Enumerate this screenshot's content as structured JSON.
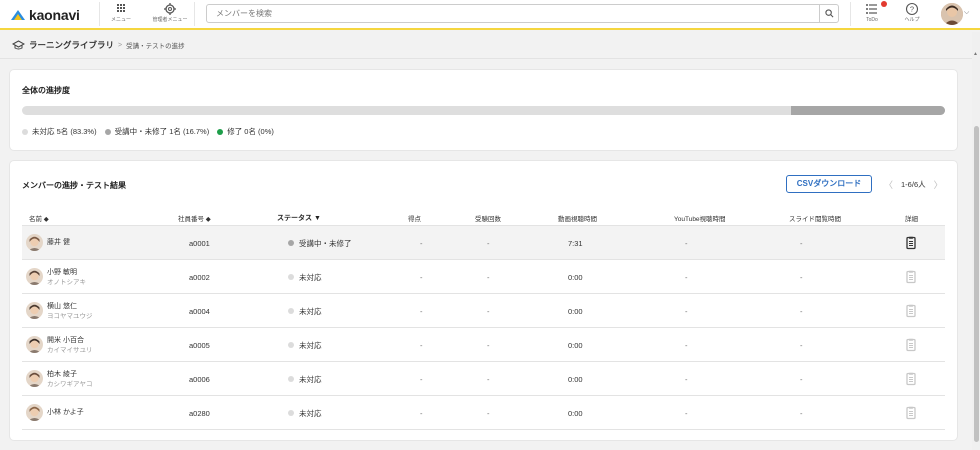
{
  "header": {
    "logo_text": "kaonavi",
    "nav": [
      {
        "label": "メニュー",
        "icon": "grid-icon"
      },
      {
        "label": "管理者メニュー",
        "icon": "gear-icon"
      }
    ],
    "search_placeholder": "メンバーを検索",
    "todo_label": "ToDo",
    "help_label": "ヘルプ"
  },
  "breadcrumb": {
    "parent": "ラーニングライブラリ",
    "separator": ">",
    "current": "受講・テストの進捗"
  },
  "overall": {
    "title": "全体の進捗度",
    "progress_in_progress_fraction": 0.167,
    "legend": [
      {
        "label": "未対応 5名 (83.3%)",
        "color": "#dcdcdc"
      },
      {
        "label": "受講中・未修了 1名 (16.7%)",
        "color": "#a6a6a6"
      },
      {
        "label": "修了 0名 (0%)",
        "color": "#1e9e4a"
      }
    ]
  },
  "members": {
    "title": "メンバーの進捗・テスト結果",
    "csv_label": "CSVダウンロード",
    "pager_text": "1-6/6人",
    "pager_prev": "〈",
    "pager_next": "〉",
    "columns": {
      "name": "名前 ◆",
      "employee_no": "社員番号 ◆",
      "status": "ステータス ▼",
      "score": "得点",
      "attempts": "受験回数",
      "video_time": "動画視聴時間",
      "youtube_time": "YouTube視聴時間",
      "slide_time": "スライド閲覧時間",
      "detail": "詳細"
    },
    "rows": [
      {
        "name": "藤井 健",
        "kana": "",
        "no": "a0001",
        "status": "受講中・未修了",
        "status_color": "#a6a6a6",
        "score": "-",
        "attempts": "-",
        "video": "7:31",
        "youtube": "-",
        "slide": "-",
        "detail_active": true
      },
      {
        "name": "小野 敏明",
        "kana": "オノトシアキ",
        "no": "a0002",
        "status": "未対応",
        "status_color": "#dcdcdc",
        "score": "-",
        "attempts": "-",
        "video": "0:00",
        "youtube": "-",
        "slide": "-",
        "detail_active": false
      },
      {
        "name": "横山 悠仁",
        "kana": "ヨコヤマユウジ",
        "no": "a0004",
        "status": "未対応",
        "status_color": "#dcdcdc",
        "score": "-",
        "attempts": "-",
        "video": "0:00",
        "youtube": "-",
        "slide": "-",
        "detail_active": false
      },
      {
        "name": "開米 小百合",
        "kana": "カイマイサユリ",
        "no": "a0005",
        "status": "未対応",
        "status_color": "#dcdcdc",
        "score": "-",
        "attempts": "-",
        "video": "0:00",
        "youtube": "-",
        "slide": "-",
        "detail_active": false
      },
      {
        "name": "柏木 綾子",
        "kana": "カシワギアヤコ",
        "no": "a0006",
        "status": "未対応",
        "status_color": "#dcdcdc",
        "score": "-",
        "attempts": "-",
        "video": "0:00",
        "youtube": "-",
        "slide": "-",
        "detail_active": false
      },
      {
        "name": "小林 かよ子",
        "kana": "",
        "no": "a0280",
        "status": "未対応",
        "status_color": "#dcdcdc",
        "score": "-",
        "attempts": "-",
        "video": "0:00",
        "youtube": "-",
        "slide": "-",
        "detail_active": false
      }
    ]
  }
}
